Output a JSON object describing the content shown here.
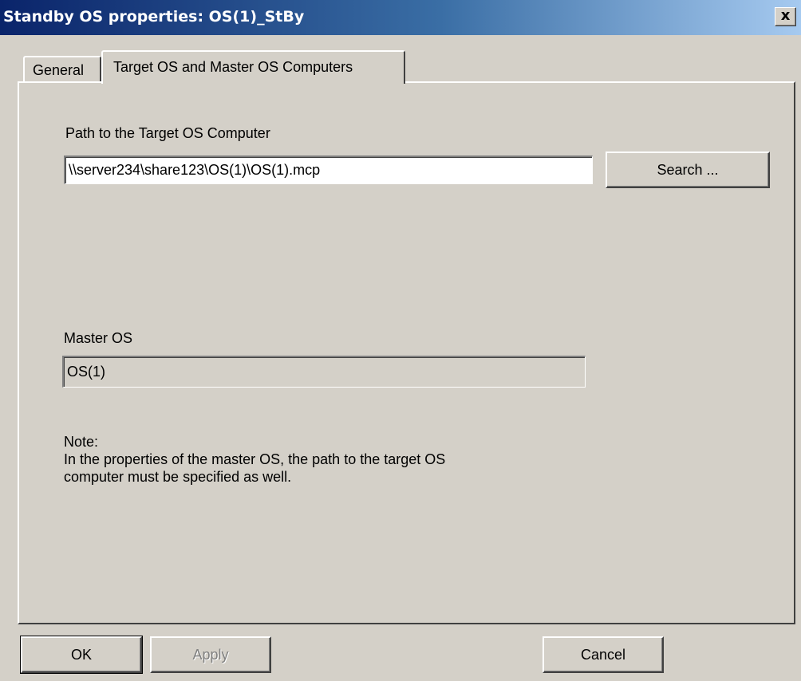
{
  "window": {
    "title": "Standby OS properties: OS(1)_StBy",
    "close_label": "x"
  },
  "tabs": [
    {
      "label": "General"
    },
    {
      "label": "Target OS and Master OS Computers",
      "active": true
    }
  ],
  "target_os": {
    "path_label": "Path to the Target OS Computer",
    "path_value": "\\\\server234\\share123\\OS(1)\\OS(1).mcp",
    "search_button": "Search ..."
  },
  "master_os": {
    "label": "Master OS",
    "value": "OS(1)"
  },
  "note": {
    "heading": "Note:",
    "line1": "In the properties of the master OS, the path to the target OS",
    "line2": "computer must be specified as well."
  },
  "buttons": {
    "ok": "OK",
    "apply": "Apply",
    "cancel": "Cancel"
  }
}
